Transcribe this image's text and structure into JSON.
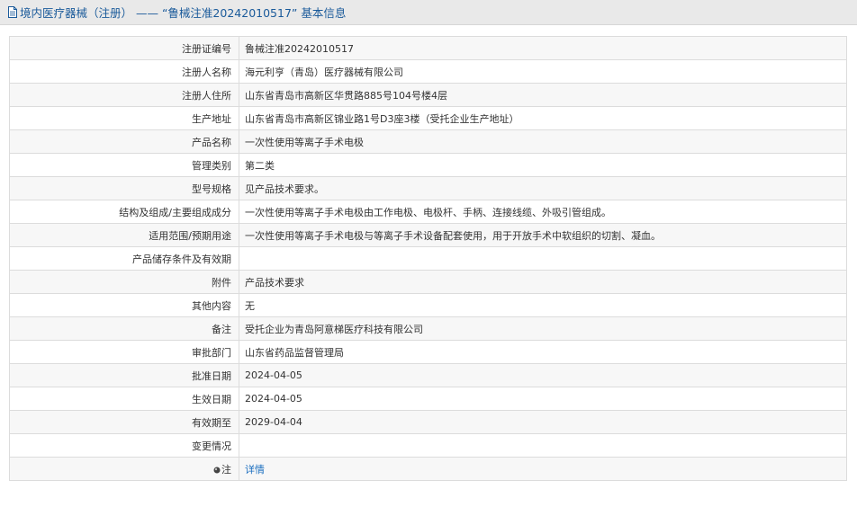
{
  "header": {
    "title": "境内医疗器械（注册） —— “鲁械注准20242010517” 基本信息"
  },
  "rows": [
    {
      "label": "注册证编号",
      "value": "鲁械注准20242010517"
    },
    {
      "label": "注册人名称",
      "value": "海元利亨（青岛）医疗器械有限公司"
    },
    {
      "label": "注册人住所",
      "value": "山东省青岛市高新区华贯路885号104号楼4层"
    },
    {
      "label": "生产地址",
      "value": "山东省青岛市高新区锦业路1号D3座3楼（受托企业生产地址）"
    },
    {
      "label": "产品名称",
      "value": "一次性使用等离子手术电极"
    },
    {
      "label": "管理类别",
      "value": "第二类"
    },
    {
      "label": "型号规格",
      "value": "见产品技术要求。"
    },
    {
      "label": "结构及组成/主要组成成分",
      "value": "一次性使用等离子手术电极由工作电极、电极杆、手柄、连接线缆、外吸引管组成。"
    },
    {
      "label": "适用范围/预期用途",
      "value": "一次性使用等离子手术电极与等离子手术设备配套使用，用于开放手术中软组织的切割、凝血。"
    },
    {
      "label": "产品储存条件及有效期",
      "value": ""
    },
    {
      "label": "附件",
      "value": "产品技术要求"
    },
    {
      "label": "其他内容",
      "value": "无"
    },
    {
      "label": "备注",
      "value": "受托企业为青岛阿意梯医疗科技有限公司"
    },
    {
      "label": "审批部门",
      "value": "山东省药品监督管理局"
    },
    {
      "label": "批准日期",
      "value": "2024-04-05"
    },
    {
      "label": "生效日期",
      "value": "2024-04-05"
    },
    {
      "label": "有效期至",
      "value": "2029-04-04"
    },
    {
      "label": "变更情况",
      "value": ""
    }
  ],
  "note": {
    "label": "注",
    "link_text": "详情",
    "icon": "note-pin-icon"
  }
}
